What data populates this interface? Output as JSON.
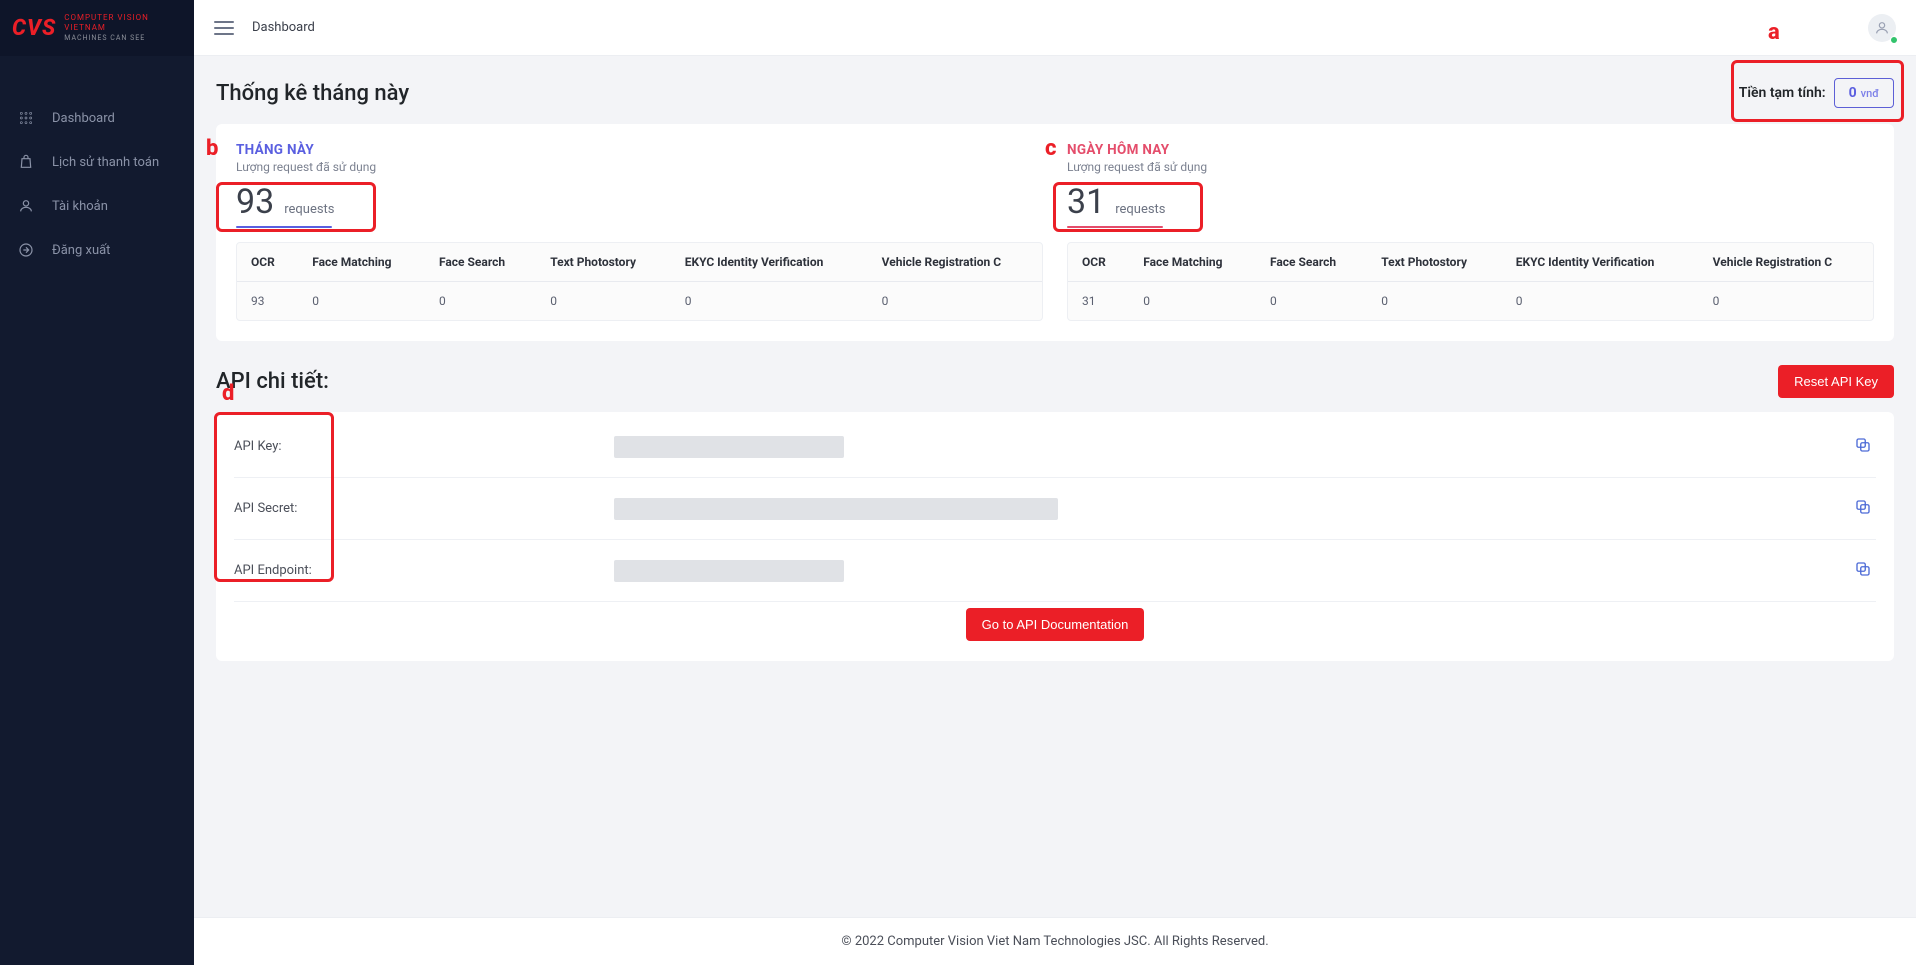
{
  "brand": {
    "mark": "CVS",
    "line1": "COMPUTER VISION",
    "line2": "VIETNAM",
    "line3": "MACHINES CAN SEE"
  },
  "header": {
    "breadcrumb": "Dashboard"
  },
  "sidebar": {
    "items": [
      {
        "label": "Dashboard"
      },
      {
        "label": "Lịch sử thanh toán"
      },
      {
        "label": "Tài khoản"
      },
      {
        "label": "Đăng xuất"
      }
    ]
  },
  "stats": {
    "title": "Thống kê tháng này",
    "balance_label": "Tiền tạm tính:",
    "balance_value": "0",
    "balance_currency": "vnđ",
    "month": {
      "title": "THÁNG NÀY",
      "subtitle": "Lượng request đã sử dụng",
      "value": "93",
      "unit": "requests",
      "columns": [
        "OCR",
        "Face Matching",
        "Face Search",
        "Text Photostory",
        "EKYC Identity Verification",
        "Vehicle Registration C"
      ],
      "row": [
        "93",
        "0",
        "0",
        "0",
        "0",
        "0"
      ]
    },
    "today": {
      "title": "NGÀY HÔM NAY",
      "subtitle": "Lượng request đã sử dụng",
      "value": "31",
      "unit": "requests",
      "columns": [
        "OCR",
        "Face Matching",
        "Face Search",
        "Text Photostory",
        "EKYC Identity Verification",
        "Vehicle Registration C"
      ],
      "row": [
        "31",
        "0",
        "0",
        "0",
        "0",
        "0"
      ]
    }
  },
  "api": {
    "section_title": "API chi tiết:",
    "reset_label": "Reset API Key",
    "rows": [
      {
        "label": "API Key:"
      },
      {
        "label": "API Secret:"
      },
      {
        "label": "API Endpoint:"
      }
    ],
    "doc_button": "Go to API Documentation"
  },
  "footer": {
    "text": "© 2022 Computer Vision Viet Nam Technologies JSC. All Rights Reserved."
  },
  "annotations": {
    "a": "a",
    "b": "b",
    "c": "c",
    "d": "d"
  }
}
